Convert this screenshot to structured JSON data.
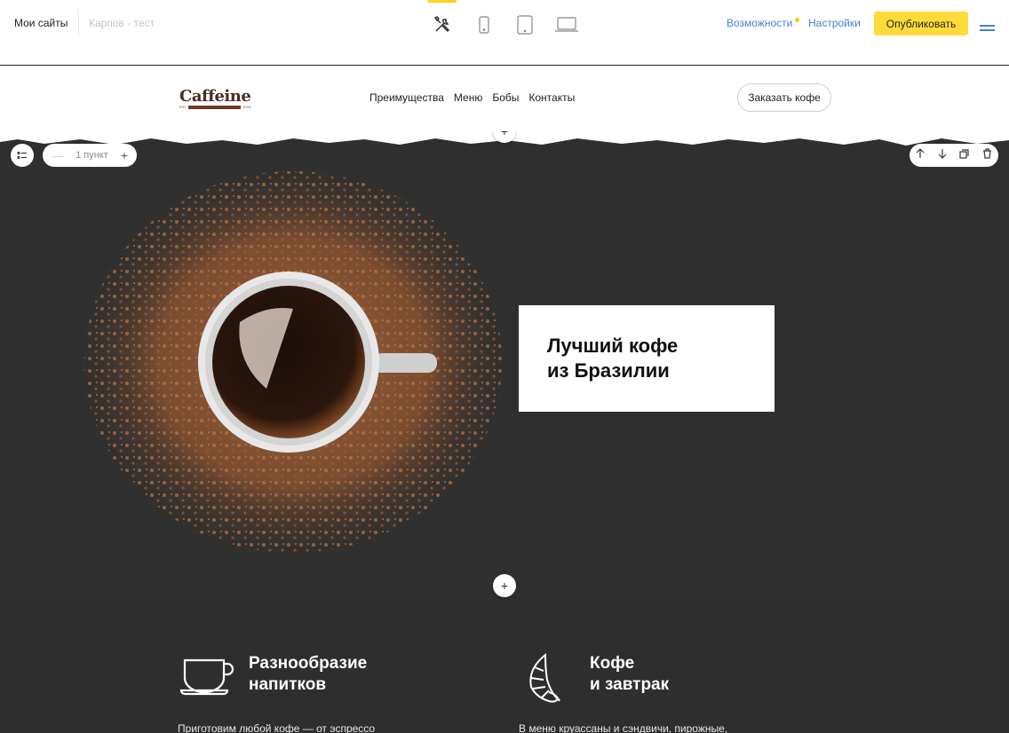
{
  "editor": {
    "my_sites": "Мои сайты",
    "site_name": "Карпов - тест",
    "devices": [
      "tools-icon",
      "phone-icon",
      "tablet-icon",
      "laptop-icon"
    ],
    "features_link": "Возможности",
    "settings_link": "Настройки",
    "publish_label": "Опубликовать",
    "accent": "#ffdb3a",
    "link_color": "#4a7fd0"
  },
  "site": {
    "logo": "Caffeine",
    "logo_sub_left": "EST.",
    "logo_sub_right": "1978",
    "nav": [
      "Преимущества",
      "Меню",
      "Бобы",
      "Контакты"
    ],
    "order_button": "Заказать кофе"
  },
  "block_controls": {
    "items_count": "1 пункт",
    "minus": "—",
    "plus": "+",
    "add": "+"
  },
  "hero": {
    "title": "Лучший кофе\nиз Бразилии"
  },
  "features": [
    {
      "title": "Разнообразие\nнапитков",
      "text": "Приготовим любой кофе — от эспрессо",
      "icon": "coffee-cup-icon"
    },
    {
      "title": "Кофе\nи завтрак",
      "text": "В меню круассаны и сэндвичи, пирожные,",
      "icon": "croissant-icon"
    }
  ]
}
